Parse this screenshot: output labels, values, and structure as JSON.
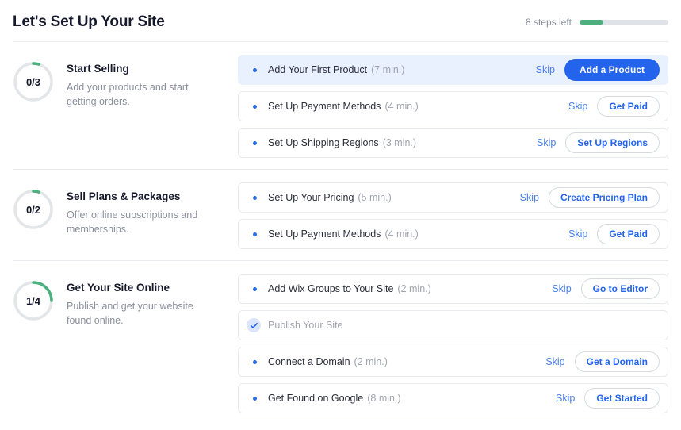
{
  "header": {
    "title": "Let's Set Up Your Site",
    "steps_left": "8 steps left",
    "progress_percent": 27,
    "progress_fill_color": "#4caf7d",
    "progress_track_color": "#dfe2e6"
  },
  "colors": {
    "primary_blue": "#2463eb",
    "link_blue": "#4a7fe8",
    "bullet_blue": "#2b6fe8",
    "highlight_bg": "#e9f0fe",
    "check_badge_bg": "#dbe6fd",
    "green": "#4caf7d",
    "ring_track": "#e3e6e9",
    "muted_text": "#8a8f9c",
    "border": "#e8eaed"
  },
  "sections": [
    {
      "progress_label": "0/3",
      "progress_ratio": 0.05,
      "title": "Start Selling",
      "description": "Add your products and start getting orders.",
      "tasks": [
        {
          "label": "Add Your First Product",
          "time": "(7 min.)",
          "skip_label": "Skip",
          "action_label": "Add a Product",
          "state": "highlight",
          "icon": "bullet-dot-icon"
        },
        {
          "label": "Set Up Payment Methods",
          "time": "(4 min.)",
          "skip_label": "Skip",
          "action_label": "Get Paid",
          "state": "default",
          "icon": "bullet-dot-icon"
        },
        {
          "label": "Set Up Shipping Regions",
          "time": "(3 min.)",
          "skip_label": "Skip",
          "action_label": "Set Up Regions",
          "state": "default",
          "icon": "bullet-dot-icon"
        }
      ]
    },
    {
      "progress_label": "0/2",
      "progress_ratio": 0.05,
      "title": "Sell Plans & Packages",
      "description": "Offer online subscriptions and memberships.",
      "tasks": [
        {
          "label": "Set Up Your Pricing",
          "time": "(5 min.)",
          "skip_label": "Skip",
          "action_label": "Create Pricing Plan",
          "state": "default",
          "icon": "bullet-dot-icon"
        },
        {
          "label": "Set Up Payment Methods",
          "time": "(4 min.)",
          "skip_label": "Skip",
          "action_label": "Get Paid",
          "state": "default",
          "icon": "bullet-dot-icon"
        }
      ]
    },
    {
      "progress_label": "1/4",
      "progress_ratio": 0.25,
      "title": "Get Your Site Online",
      "description": "Publish and get your website found online.",
      "tasks": [
        {
          "label": "Add Wix Groups to Your Site",
          "time": "(2 min.)",
          "skip_label": "Skip",
          "action_label": "Go to Editor",
          "state": "default",
          "icon": "bullet-dot-icon"
        },
        {
          "label": "Publish Your Site",
          "time": "",
          "skip_label": "",
          "action_label": "",
          "state": "done",
          "icon": "check-circle-icon"
        },
        {
          "label": "Connect a Domain",
          "time": "(2 min.)",
          "skip_label": "Skip",
          "action_label": "Get a Domain",
          "state": "default",
          "icon": "bullet-dot-icon"
        },
        {
          "label": "Get Found on Google",
          "time": "(8 min.)",
          "skip_label": "Skip",
          "action_label": "Get Started",
          "state": "default",
          "icon": "bullet-dot-icon"
        }
      ]
    }
  ]
}
